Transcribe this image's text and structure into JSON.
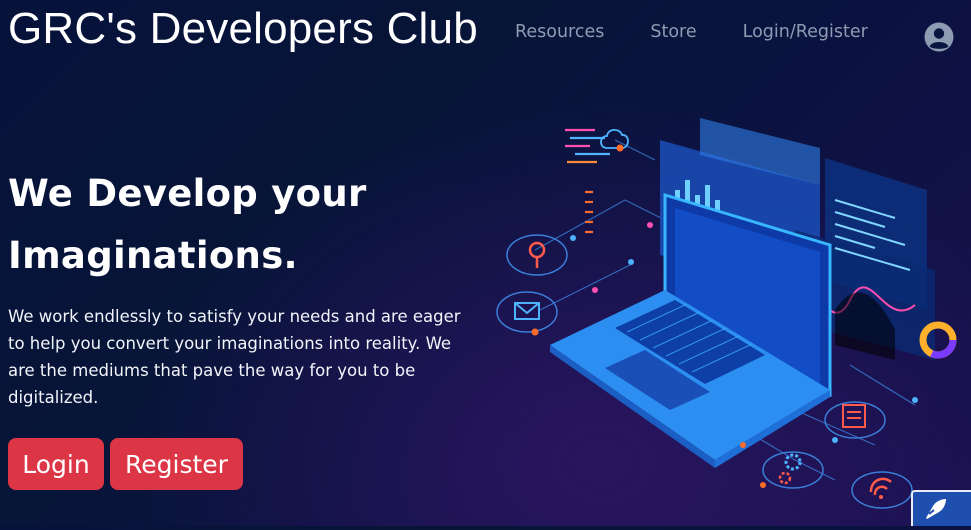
{
  "header": {
    "brand": "GRC's Developers Club",
    "nav": [
      {
        "label": "Resources"
      },
      {
        "label": "Store"
      },
      {
        "label": "Login/Register"
      }
    ],
    "user_icon": "user-circle-icon"
  },
  "hero": {
    "title_line1": "We Develop your",
    "title_line2": "Imaginations.",
    "description": "We work endlessly to satisfy your needs and are eager to help you convert your imaginations into reality. We are the mediums that pave the way for you to be digitalized.",
    "buttons": {
      "login": "Login",
      "register": "Register"
    },
    "illustration": "isometric-laptop-dashboard-illustration"
  },
  "colors": {
    "background": "#07123a",
    "nav_text": "#8e9bb3",
    "button": "#dc3545",
    "accent_cyan": "#2fb8ff",
    "accent_pink": "#ff4fb0"
  },
  "badge_icon": "rocket-icon"
}
